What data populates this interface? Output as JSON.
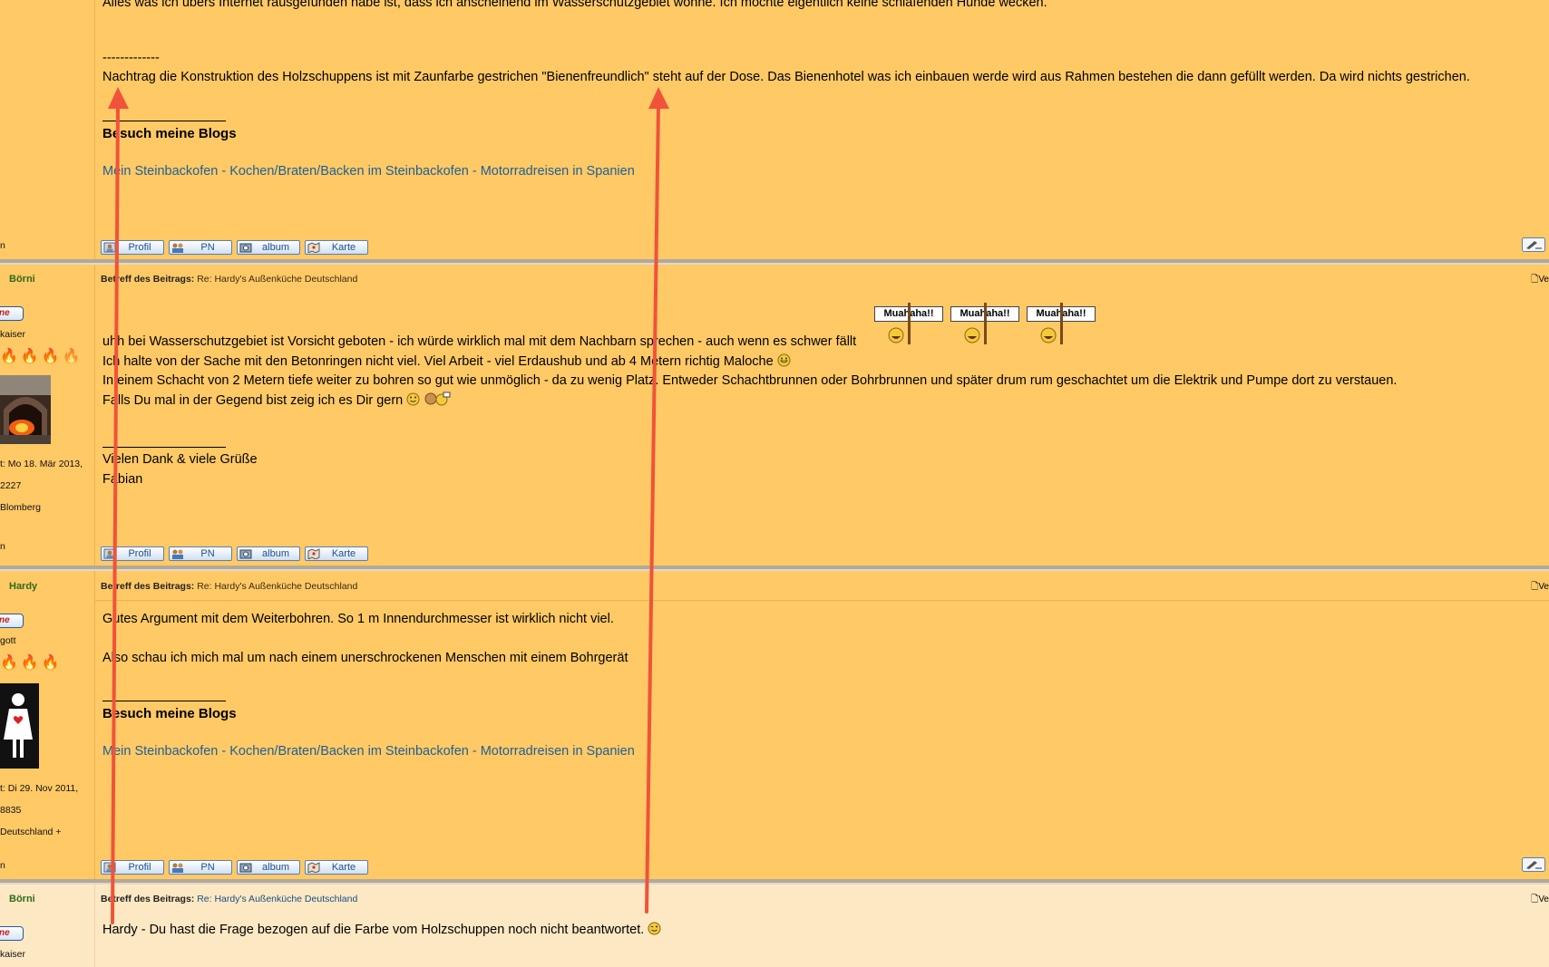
{
  "posts": [
    {
      "body_lines": [
        "Alles was ich übers Internet rausgefunden habe ist, dass ich anscheinend im Wasserschutzgebiet wohne. Ich möchte eigentlich keine schlafenden Hunde wecken."
      ],
      "divider": "-------------",
      "nachtrag": "Nachtrag die Konstruktion des Holzschuppens ist mit Zaunfarbe gestrichen \"Bienenfreundlich\" steht auf der Dose. Das Bienenhotel was ich einbauen werde wird aus Rahmen bestehen die dann gefüllt werden. Da wird nichts gestrichen.",
      "signature_title": "Besuch meine Blogs",
      "signature_link": "Mein Steinbackofen - Kochen/Braten/Backen im Steinbackofen - Motorradreisen in Spanien",
      "side_footer": "n"
    },
    {
      "author": "Börni",
      "status": "ne",
      "rank": "kaiser",
      "flames": [
        "on",
        "on",
        "on",
        "off"
      ],
      "joined": "t: Mo 18. Mär 2013,",
      "posts_count": "2227",
      "location": "Blomberg",
      "side_footer": "n",
      "subject_label": "Betreff des Beitrags:",
      "subject_value": "Re: Hardy's Außenküche Deutschland",
      "smiley_sign": "Muahaha!!",
      "body_lines": [
        "uhh bei Wasserschutzgebiet ist Vorsicht geboten - ich würde wirklich mal mit dem Nachbarn sprechen - auch wenn es schwer fällt",
        "Ich halte von der Sache mit den Betonringen nicht viel. Viel Arbeit - viel Erdaushub und ab 4 Metern richtig Maloche",
        "In einem Schacht von 2 Metern tiefe weiter zu bohren so gut wie unmöglich - da zu wenig Platz. Entweder Schachtbrunnen oder Bohrbrunnen und später drum rum geschachtet um die Elektrik und Pumpe dort zu verstauen.",
        "Falls Du mal in der Gegend bist zeig ich es Dir gern"
      ],
      "sig_lines": [
        "Vielen Dank & viele Grüße",
        "Fabian"
      ]
    },
    {
      "author": "Hardy",
      "status": "ne",
      "rank": "gott",
      "flames": [
        "on",
        "on",
        "on"
      ],
      "joined": "t: Di 29. Nov 2011,",
      "posts_count": "8835",
      "location": "Deutschland +",
      "side_footer": "n",
      "subject_label": "Betreff des Beitrags:",
      "subject_value": "Re: Hardy's Außenküche Deutschland",
      "body_lines": [
        "Gutes Argument mit dem Weiterbohren. So 1 m Innendurchmesser ist wirklich nicht viel.",
        "Also schau ich mich mal um nach einem unerschrockenen Menschen mit einem Bohrgerät"
      ],
      "signature_title": "Besuch meine Blogs",
      "signature_link": "Mein Steinbackofen - Kochen/Braten/Backen im Steinbackofen - Motorradreisen in Spanien"
    },
    {
      "author": "Börni",
      "status": "ne",
      "rank": "kaiser",
      "subject_label": "Betreff des Beitrags:",
      "subject_value": "Re: Hardy's Außenküche Deutschland",
      "body_lines": [
        "Hardy - Du hast die Frage bezogen auf die Farbe vom Holzschuppen noch nicht beantwortet."
      ]
    }
  ],
  "buttons": {
    "profile": "Profil",
    "pm": "PN",
    "album": "album",
    "map": "Karte"
  },
  "corner_label": "Ve",
  "colors": {
    "post_bg": "#ffc966",
    "post_bg_light": "#fce8c2",
    "link": "#1f5f97",
    "arrow": "#f0533a",
    "author": "#2f6a1c"
  }
}
